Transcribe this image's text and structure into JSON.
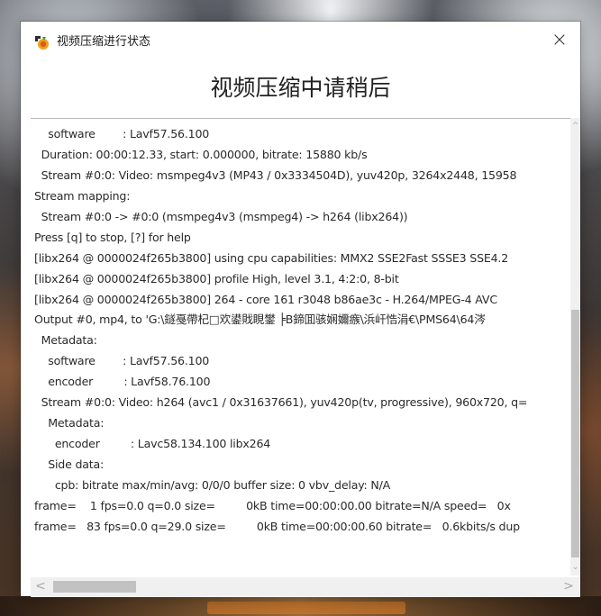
{
  "window": {
    "title": "视频压缩进行状态",
    "close_glyph": "×",
    "heading": "视频压缩中请稍后"
  },
  "icons": {
    "app": "app-logo-icon",
    "close": "close-icon",
    "scroll_up": "chevron-up-icon",
    "scroll_down": "chevron-down-icon",
    "scroll_left": "chevron-left-icon",
    "scroll_right": "chevron-right-icon"
  },
  "log": {
    "lines": [
      "    software        : Lavf57.56.100",
      "  Duration: 00:00:12.33, start: 0.000000, bitrate: 15880 kb/s",
      "  Stream #0:0: Video: msmpeg4v3 (MP43 / 0x3334504D), yuv420p, 3264x2448, 15958",
      "Stream mapping:",
      "  Stream #0:0 -> #0:0 (msmpeg4v3 (msmpeg4) -> h264 (libx264))",
      "Press [q] to stop, [?] for help",
      "[libx264 @ 0000024f265b3800] using cpu capabilities: MMX2 SSE2Fast SSSE3 SSE4.2",
      "[libx264 @ 0000024f265b3800] profile High, level 3.1, 4:2:0, 8-bit",
      "[libx264 @ 0000024f265b3800] 264 - core 161 r3048 b86ae3c - H.264/MPEG-4 AVC",
      "Output #0, mp4, to 'G:\\鐩戞帶杞□欢鍙戝睍鐢 ╞B鍗囬骇娴嬭瘯\\浜屽悎涓€\\PMS64\\64涔",
      "  Metadata:",
      "    software        : Lavf57.56.100",
      "    encoder         : Lavf58.76.100",
      "  Stream #0:0: Video: h264 (avc1 / 0x31637661), yuv420p(tv, progressive), 960x720, q=",
      "    Metadata:",
      "      encoder         : Lavc58.134.100 libx264",
      "    Side data:",
      "      cpb: bitrate max/min/avg: 0/0/0 buffer size: 0 vbv_delay: N/A",
      "frame=    1 fps=0.0 q=0.0 size=         0kB time=00:00:00.00 bitrate=N/A speed=   0x",
      "frame=   83 fps=0.0 q=29.0 size=         0kB time=00:00:00.60 bitrate=   0.6kbits/s dup"
    ]
  },
  "scrollbars": {
    "up": "^",
    "down": "⌄",
    "left": "<",
    "right": ">"
  }
}
